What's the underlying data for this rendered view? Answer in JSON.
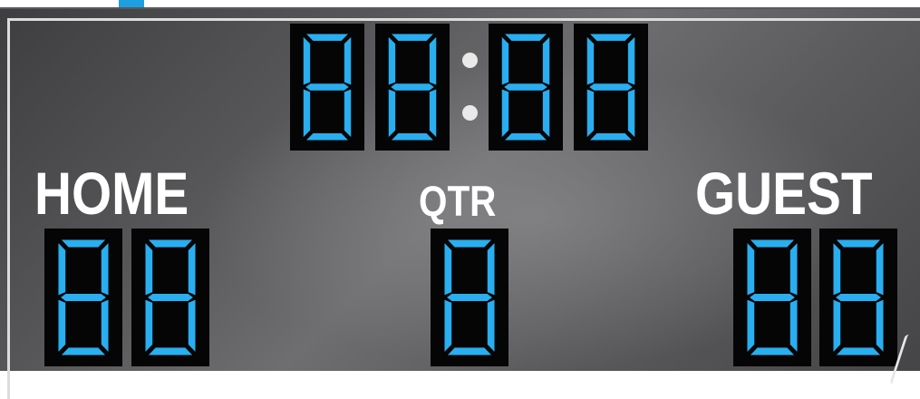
{
  "scoreboard": {
    "colors": {
      "segment": "#29aef0",
      "digit_background": "#050505",
      "panel": "#5e5e60",
      "label_text": "#ffffff",
      "accent": "#1e9fdf"
    },
    "clock": {
      "digits": [
        "8",
        "8",
        "8",
        "8"
      ],
      "separator": ":"
    },
    "home": {
      "label": "HOME",
      "score_digits": [
        "8",
        "8"
      ]
    },
    "quarter": {
      "label": "QTR",
      "digit": "8"
    },
    "guest": {
      "label": "GUEST",
      "score_digits": [
        "8",
        "8"
      ]
    }
  }
}
